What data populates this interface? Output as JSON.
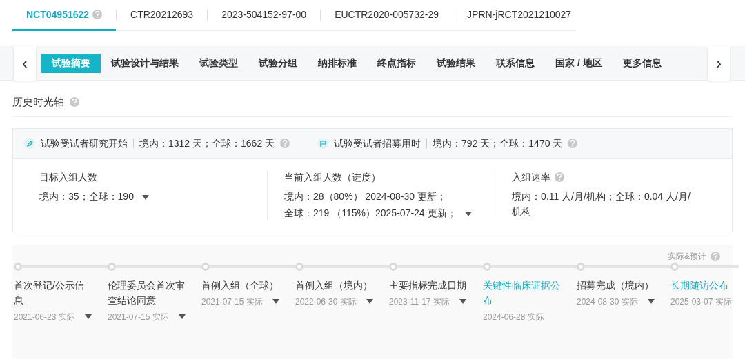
{
  "id_tabs": [
    {
      "label": "NCT04951622",
      "selected": true,
      "help": true
    },
    {
      "label": "CTR20212693",
      "selected": false,
      "help": false
    },
    {
      "label": "2023-504152-97-00",
      "selected": false,
      "help": false
    },
    {
      "label": "EUCTR2020-005732-29",
      "selected": false,
      "help": false
    },
    {
      "label": "JPRN-jRCT2021210027",
      "selected": false,
      "help": false
    }
  ],
  "section_nav": {
    "prev": "‹",
    "next": "›",
    "items": [
      {
        "label": "试验摘要",
        "selected": true
      },
      {
        "label": "试验设计与结果",
        "selected": false
      },
      {
        "label": "试验类型",
        "selected": false
      },
      {
        "label": "试验分组",
        "selected": false
      },
      {
        "label": "纳排标准",
        "selected": false
      },
      {
        "label": "终点指标",
        "selected": false
      },
      {
        "label": "试验结果",
        "selected": false
      },
      {
        "label": "联系信息",
        "selected": false
      },
      {
        "label": "国家 / 地区",
        "selected": false
      },
      {
        "label": "更多信息",
        "selected": false
      }
    ]
  },
  "section_title": "历史时光轴",
  "durations": [
    {
      "kind": "pen",
      "label": "试验受试者研究开始",
      "value": "境内：1312 天；全球：1662 天"
    },
    {
      "kind": "flag",
      "label": "试验受试者招募用时",
      "value": "境内：792 天；全球：1470 天"
    }
  ],
  "stats": [
    {
      "label": "目标入组人数",
      "help": false,
      "lines": [
        "境内：35；全球：190"
      ],
      "expandable": true
    },
    {
      "label": "当前入组人数（进度）",
      "help": false,
      "lines": [
        "境内：28（80%） 2024-08-30 更新；",
        "全球：219 （115%）2025-07-24 更新；"
      ],
      "expandable": true
    },
    {
      "label": "入组速率",
      "help": true,
      "lines": [
        "境内：0.11 人/月/机构；全球：0.04 人/月/机构"
      ],
      "expandable": false
    }
  ],
  "timeline": {
    "legend": "实际&预计",
    "events": [
      {
        "title": "首次登记/公示信息",
        "date": "2021-06-23 实际",
        "link": false,
        "expandable": true
      },
      {
        "title": "伦理委员会首次审查结论同意",
        "date": "2021-07-15 实际",
        "link": false,
        "expandable": true
      },
      {
        "title": "首例入组（全球）",
        "date": "2021-07-15 实际",
        "link": false,
        "expandable": true
      },
      {
        "title": "首例入组（境内）",
        "date": "2022-06-30 实际",
        "link": false,
        "expandable": true
      },
      {
        "title": "主要指标完成日期",
        "date": "2023-11-17 实际",
        "link": false,
        "expandable": true
      },
      {
        "title": "关键性临床证据公布",
        "date": "2024-06-28 实际",
        "link": true,
        "expandable": false
      },
      {
        "title": "招募完成（境内）",
        "date": "2024-08-30 实际",
        "link": false,
        "expandable": true
      },
      {
        "title": "长期随访公布",
        "date": "2025-03-07 实际",
        "link": true,
        "expandable": false
      }
    ]
  }
}
